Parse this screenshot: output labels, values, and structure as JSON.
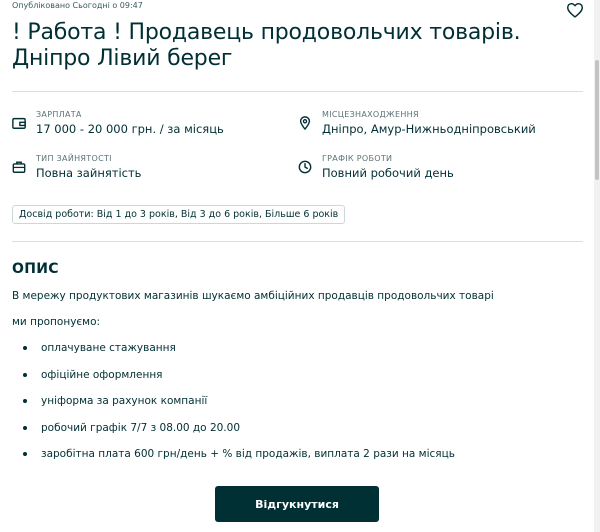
{
  "published": "Опубліковано Сьогодні о 09:47",
  "title_line1": "! Работа ! Продавець продовольчих товарів.",
  "title_line2": "Дніпро Лівий берег",
  "props": {
    "salary": {
      "label": "ЗАРПЛАТА",
      "value": "17 000 - 20 000 грн. / за місяць",
      "icon": "wallet-icon"
    },
    "location": {
      "label": "МІСЦЕЗНАХОДЖЕННЯ",
      "value": "Дніпро, Амур-Нижньодніпровський",
      "icon": "location-pin-icon"
    },
    "employment": {
      "label": "ТИП ЗАЙНЯТОСТІ",
      "value": "Повна зайнятість",
      "icon": "briefcase-icon"
    },
    "schedule": {
      "label": "ГРАФІК РОБОТИ",
      "value": "Повний робочий день",
      "icon": "clock-icon"
    }
  },
  "experience_tag": "Досвід роботи: Від 1 до 3 років, Від 3 до 6 років, Більше 6 років",
  "description": {
    "title": "ОПИС",
    "line1": "В мережу продуктових магазинів шукаємо амбіційних продавців продовольчих товарі",
    "line2": "ми пропонуємо:",
    "bullets": [
      "оплачуване стажування",
      "офіційне оформлення",
      "уніформа за рахунок компанії",
      "робочий графік 7/7 з 08.00 до 20.00",
      "заробітна плата 600 грн/день + % від продажів, виплата 2 рази на місяць"
    ]
  },
  "apply_button": "Відгукнутися",
  "colors": {
    "primary": "#002f34",
    "muted": "#5b7276",
    "divider": "#d8dfe0"
  }
}
